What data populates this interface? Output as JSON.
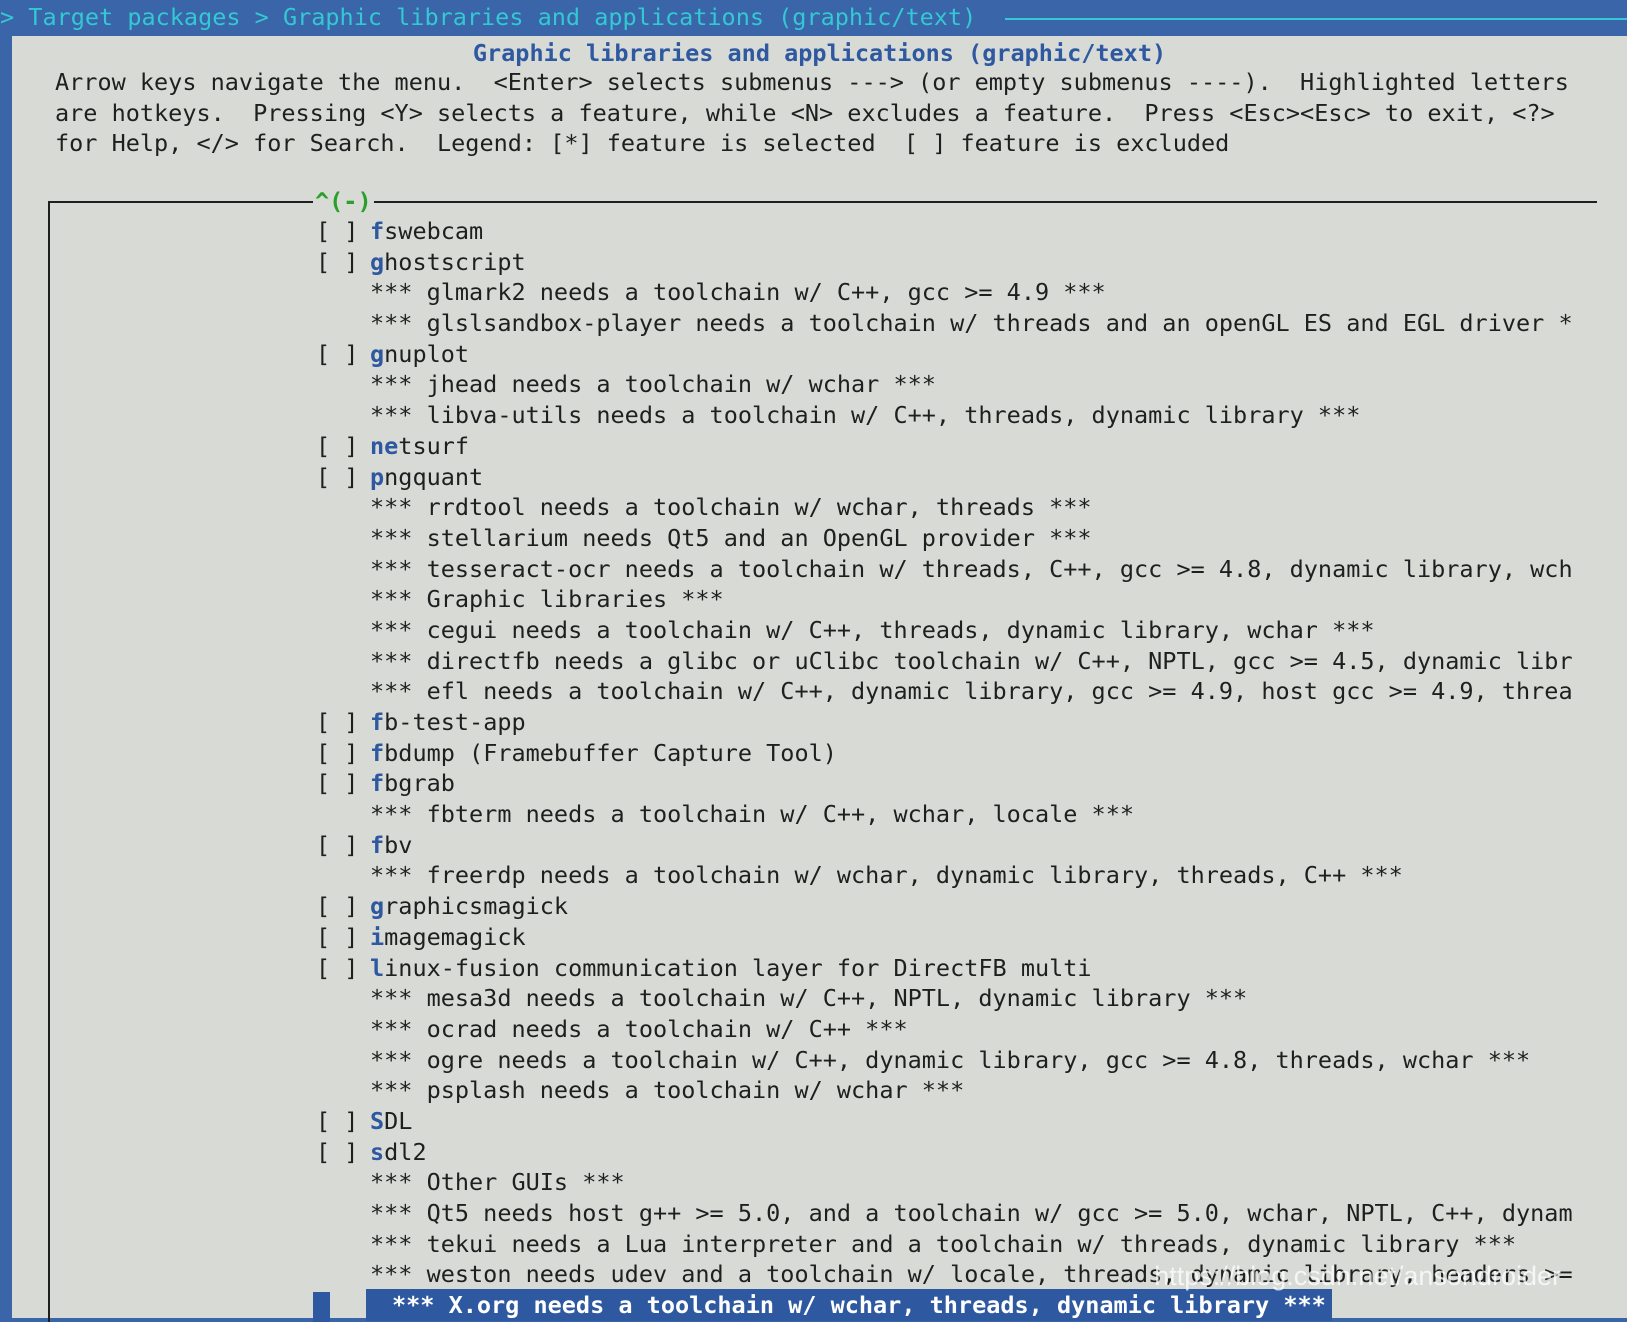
{
  "breadcrumb": "> Target packages > Graphic libraries and applications (graphic/text)",
  "title": "Graphic libraries and applications (graphic/text)",
  "help_lines": [
    "Arrow keys navigate the menu.  <Enter> selects submenus ---> (or empty submenus ----).  Highlighted letters",
    "are hotkeys.  Pressing <Y> selects a feature, while <N> excludes a feature.  Press <Esc><Esc> to exit, <?>",
    "for Help, </> for Search.  Legend: [*] feature is selected  [ ] feature is excluded"
  ],
  "scroll_indicator": "^(-)",
  "menu_items": [
    {
      "checkbox": "[ ]",
      "hot": "f",
      "rest": "swebcam"
    },
    {
      "checkbox": "[ ]",
      "hot": "g",
      "rest": "hostscript"
    },
    {
      "comment": "*** glmark2 needs a toolchain w/ C++, gcc >= 4.9 ***"
    },
    {
      "comment": "*** glslsandbox-player needs a toolchain w/ threads and an openGL ES and EGL driver *"
    },
    {
      "checkbox": "[ ]",
      "hot": "g",
      "rest": "nuplot"
    },
    {
      "comment": "*** jhead needs a toolchain w/ wchar ***"
    },
    {
      "comment": "*** libva-utils needs a toolchain w/ C++, threads, dynamic library ***"
    },
    {
      "checkbox": "[ ]",
      "hot": "ne",
      "rest": "tsurf"
    },
    {
      "checkbox": "[ ]",
      "hot": "p",
      "rest": "ngquant"
    },
    {
      "comment": "*** rrdtool needs a toolchain w/ wchar, threads ***"
    },
    {
      "comment": "*** stellarium needs Qt5 and an OpenGL provider ***"
    },
    {
      "comment": "*** tesseract-ocr needs a toolchain w/ threads, C++, gcc >= 4.8, dynamic library, wch"
    },
    {
      "comment": "*** Graphic libraries ***"
    },
    {
      "comment": "*** cegui needs a toolchain w/ C++, threads, dynamic library, wchar ***"
    },
    {
      "comment": "*** directfb needs a glibc or uClibc toolchain w/ C++, NPTL, gcc >= 4.5, dynamic libr"
    },
    {
      "comment": "*** efl needs a toolchain w/ C++, dynamic library, gcc >= 4.9, host gcc >= 4.9, threa"
    },
    {
      "checkbox": "[ ]",
      "hot": "f",
      "rest": "b-test-app"
    },
    {
      "checkbox": "[ ]",
      "hot": "f",
      "rest": "bdump (Framebuffer Capture Tool)"
    },
    {
      "checkbox": "[ ]",
      "hot": "f",
      "rest": "bgrab"
    },
    {
      "comment": "*** fbterm needs a toolchain w/ C++, wchar, locale ***"
    },
    {
      "checkbox": "[ ]",
      "hot": "f",
      "rest": "bv"
    },
    {
      "comment": "*** freerdp needs a toolchain w/ wchar, dynamic library, threads, C++ ***"
    },
    {
      "checkbox": "[ ]",
      "hot": "g",
      "rest": "raphicsmagick"
    },
    {
      "checkbox": "[ ]",
      "hot": "i",
      "rest": "magemagick"
    },
    {
      "checkbox": "[ ]",
      "hot": "l",
      "rest": "inux-fusion communication layer for DirectFB multi"
    },
    {
      "comment": "*** mesa3d needs a toolchain w/ C++, NPTL, dynamic library ***"
    },
    {
      "comment": "*** ocrad needs a toolchain w/ C++ ***"
    },
    {
      "comment": "*** ogre needs a toolchain w/ C++, dynamic library, gcc >= 4.8, threads, wchar ***"
    },
    {
      "comment": "*** psplash needs a toolchain w/ wchar ***"
    },
    {
      "checkbox": "[ ]",
      "hot": "S",
      "rest": "DL"
    },
    {
      "checkbox": "[ ]",
      "hot": "s",
      "rest": "dl2"
    },
    {
      "comment": "*** Other GUIs ***"
    },
    {
      "comment": "*** Qt5 needs host g++ >= 5.0, and a toolchain w/ gcc >= 5.0, wchar, NPTL, C++, dynam"
    },
    {
      "comment": "*** tekui needs a Lua interpreter and a toolchain w/ threads, dynamic library ***"
    },
    {
      "comment": "*** weston needs udev and a toolchain w/ locale, threads, dynamic library, headers >="
    },
    {
      "comment": "*** X.org needs a toolchain w/ wchar, threads, dynamic library ***",
      "selected": true
    }
  ],
  "watermark": "https://blog.csdn.net/ansondroider",
  "colors": {
    "background": "#3a65a8",
    "dialog": "#d8dad6",
    "hotkey": "#2e58a0",
    "breadcrumb": "#34c8d4",
    "scroll_indicator": "#2aa02a",
    "selection": "#2e58a0"
  }
}
